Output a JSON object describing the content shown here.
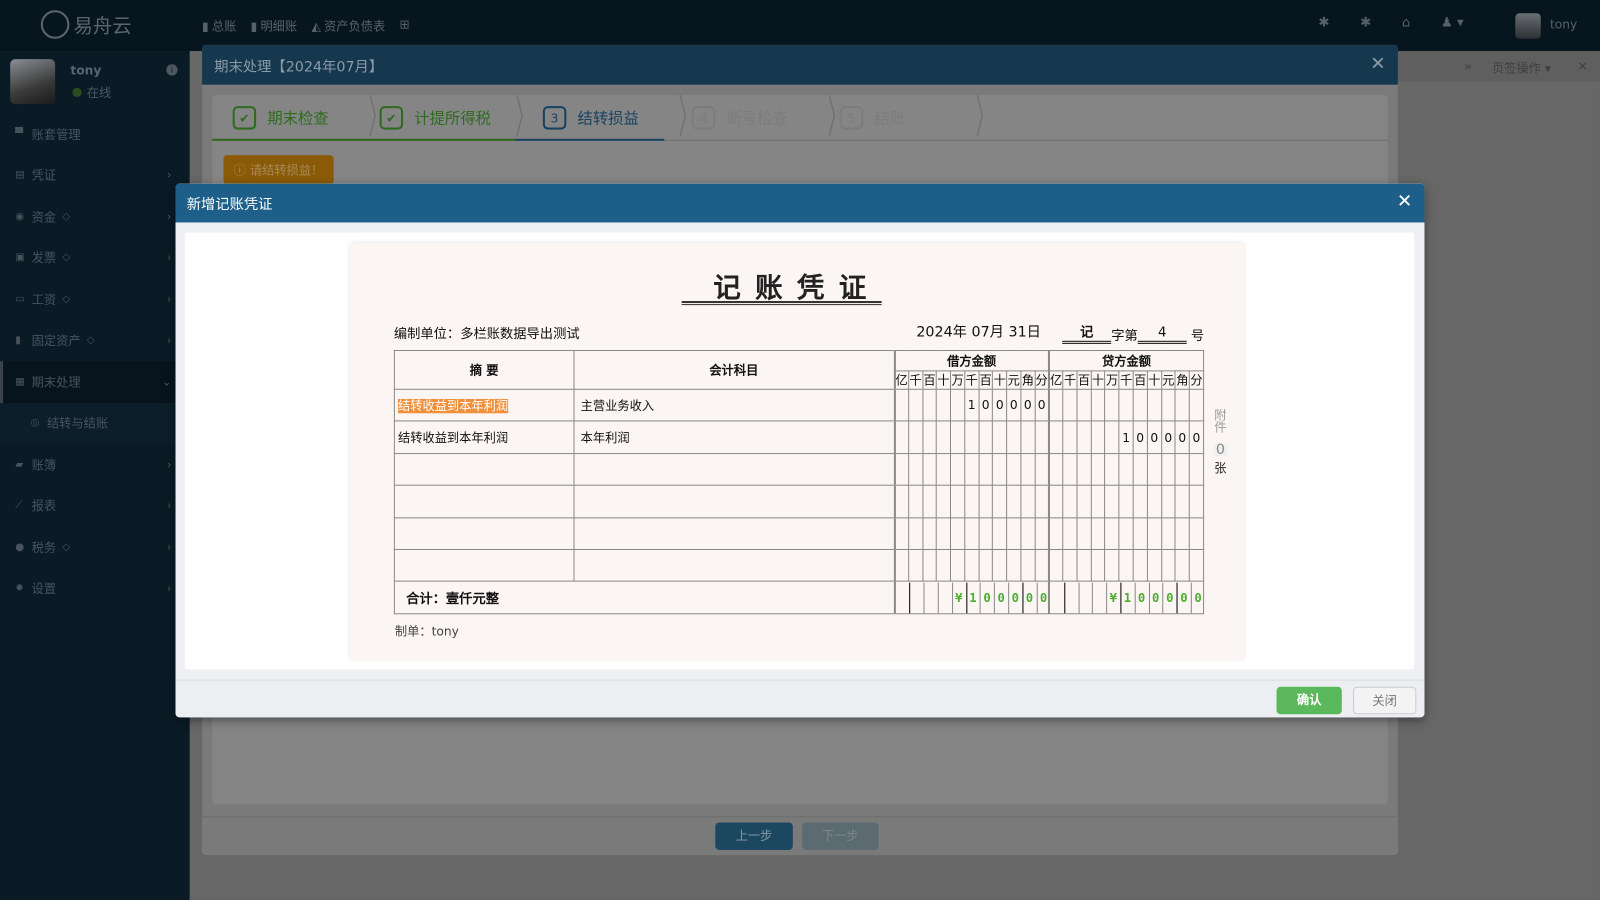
{
  "topbar": {
    "logo": "易舟云",
    "nav": [
      {
        "icon": "bookmark-icon",
        "label": "总账"
      },
      {
        "icon": "bookmark-icon",
        "label": "明细账"
      },
      {
        "icon": "area-chart-icon",
        "label": "资产负债表"
      }
    ],
    "add_icon": "plus-square-icon",
    "user": "tony"
  },
  "sidebar": {
    "user": {
      "name": "tony",
      "status": "在线"
    },
    "items": [
      {
        "label": "账套管理",
        "icon": "archive-icon",
        "chev": ""
      },
      {
        "label": "凭证",
        "icon": "voucher-icon",
        "chev": "›"
      },
      {
        "label": "资金",
        "icon": "eye-icon",
        "gem": true,
        "chev": "›"
      },
      {
        "label": "发票",
        "icon": "invoice-icon",
        "gem": true,
        "chev": "›"
      },
      {
        "label": "工资",
        "icon": "card-icon",
        "gem": true,
        "chev": "›"
      },
      {
        "label": "固定资产",
        "icon": "building-icon",
        "gem": true,
        "chev": "›"
      },
      {
        "label": "期末处理",
        "icon": "calendar-icon",
        "chev": "⌄",
        "active": true
      },
      {
        "label": "结转与结账",
        "icon": "circle-icon",
        "chev": "",
        "sub": true
      },
      {
        "label": "账簿",
        "icon": "book-icon",
        "chev": "›"
      },
      {
        "label": "报表",
        "icon": "line-chart-icon",
        "chev": "›"
      },
      {
        "label": "税务",
        "icon": "tax-icon",
        "gem": true,
        "chev": "›"
      },
      {
        "label": "设置",
        "icon": "gear-icon",
        "chev": "›"
      }
    ]
  },
  "tabbar": {
    "label": "页签操作"
  },
  "outer": {
    "title": "期末处理【2024年07月】",
    "steps": [
      {
        "n": "✔",
        "label": "期末检查",
        "state": "done"
      },
      {
        "n": "✔",
        "label": "计提所得税",
        "state": "done"
      },
      {
        "n": "3",
        "label": "结转损益",
        "state": "cur"
      },
      {
        "n": "4",
        "label": "断号检查",
        "state": "todo"
      },
      {
        "n": "5",
        "label": "结账",
        "state": "todo"
      }
    ],
    "warning": "请结转损益！",
    "prev": "上一步",
    "next": "下一步"
  },
  "inner": {
    "title": "新增记账凭证",
    "confirm": "确认",
    "close": "关闭"
  },
  "voucher": {
    "title": "记账凭证",
    "unit_label": "编制单位：",
    "unit": "多栏账数据导出测试",
    "date": "2024年 07月 31日",
    "word": "记",
    "word_suffix": "字第",
    "number": "4",
    "number_suffix": "号",
    "headers": {
      "summary": "摘  要",
      "account": "会计科目",
      "debit": "借方金额",
      "credit": "贷方金额",
      "digits": [
        "亿",
        "千",
        "百",
        "十",
        "万",
        "千",
        "百",
        "十",
        "元",
        "角",
        "分"
      ]
    },
    "rows": [
      {
        "summary": "结转收益到本年利润",
        "account": "主营业务收入",
        "debit": "100000",
        "credit": ""
      },
      {
        "summary": "结转收益到本年利润",
        "account": "本年利润",
        "debit": "",
        "credit": "100000"
      },
      {
        "summary": "",
        "account": "",
        "debit": "",
        "credit": ""
      },
      {
        "summary": "",
        "account": "",
        "debit": "",
        "credit": ""
      },
      {
        "summary": "",
        "account": "",
        "debit": "",
        "credit": ""
      },
      {
        "summary": "",
        "account": "",
        "debit": "",
        "credit": ""
      }
    ],
    "total_label": "合计：壹仟元整",
    "total_debit": "¥100000",
    "total_credit": "¥100000",
    "attach_label": "附件",
    "attach_count": "0",
    "attach_unit": "张",
    "maker": "制单：tony"
  },
  "colors": {
    "primary": "#1e5f8a",
    "confirm": "#5cb85c",
    "total": "#4cae2c",
    "highlight": "#f0903a"
  }
}
